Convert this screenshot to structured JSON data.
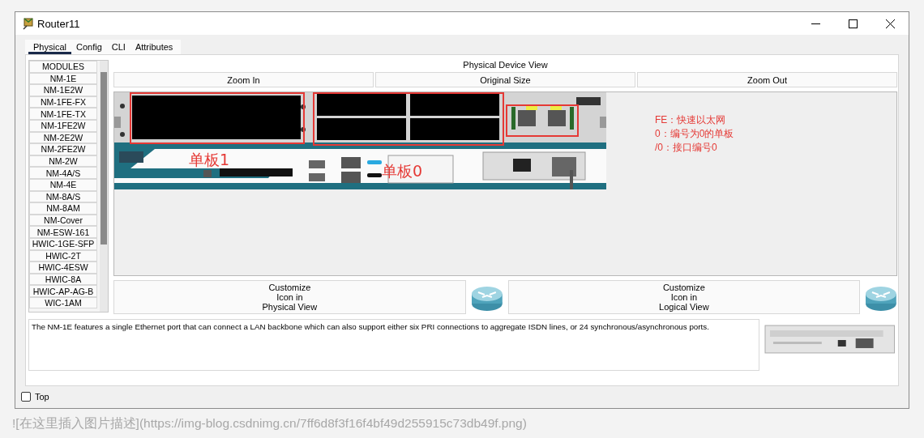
{
  "window": {
    "title": "Router11"
  },
  "tabs": [
    {
      "label": "Physical",
      "selected": true
    },
    {
      "label": "Config",
      "selected": false
    },
    {
      "label": "CLI",
      "selected": false
    },
    {
      "label": "Attributes",
      "selected": false
    }
  ],
  "modules": {
    "header": "MODULES",
    "items": [
      "NM-1E",
      "NM-1E2W",
      "NM-1FE-FX",
      "NM-1FE-TX",
      "NM-1FE2W",
      "NM-2E2W",
      "NM-2FE2W",
      "NM-2W",
      "NM-4A/S",
      "NM-4E",
      "NM-8A/S",
      "NM-8AM",
      "NM-Cover",
      "NM-ESW-161",
      "HWIC-1GE-SFP",
      "HWIC-2T",
      "HWIC-4ESW",
      "HWIC-8A",
      "HWIC-AP-AG-B",
      "WIC-1AM"
    ]
  },
  "device_view": {
    "title": "Physical Device View",
    "zoom_buttons": [
      "Zoom In",
      "Original Size",
      "Zoom Out"
    ],
    "slot_labels": [
      "单板1",
      "单板0"
    ],
    "notes": [
      "FE：快速以太网",
      "0：编号为0的单板",
      "/0：接口编号0"
    ]
  },
  "customize_buttons": [
    "Customize\nIcon in\nPhysical View",
    "Customize\nIcon in\nLogical View"
  ],
  "description": "The NM-1E features a single Ethernet port that can connect a LAN backbone which can also support either six PRI connections to aggregate ISDN lines, or 24 synchronous/asynchronous ports.",
  "top_option": {
    "label": "Top",
    "checked": false
  },
  "editor_line": "![在这里插入图片描述](https://img-blog.csdnimg.cn/7ff6d8f3f16f4bf49d255915c73db49f.png)"
}
